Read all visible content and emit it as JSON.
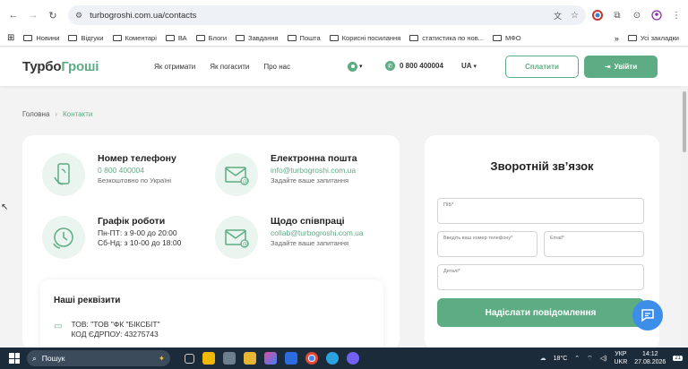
{
  "browser": {
    "url": "turbogroshi.com.ua/contacts"
  },
  "bookmarks": {
    "items": [
      "Новини",
      "Відгуки",
      "Коментарі",
      "ВА",
      "Блоги",
      "Завдання",
      "Пошта",
      "Корисні посилання",
      "статистика по нов...",
      "МФО"
    ],
    "all": "Усі закладки"
  },
  "header": {
    "logo_a": "Турбо",
    "logo_b": "Гроші",
    "nav": [
      "Як отримати",
      "Як погасити",
      "Про нас"
    ],
    "phone": "0 800 400004",
    "lang": "UA",
    "pay": "Сплатити",
    "login": "Увійти"
  },
  "breadcrumb": {
    "home": "Головна",
    "current": "Контакти"
  },
  "contacts": {
    "phone": {
      "title": "Номер телефону",
      "value": "0 800 400004",
      "note": "Безкоштовно по Україні"
    },
    "email": {
      "title": "Електронна пошта",
      "value": "info@turbogroshi.com.ua",
      "note": "Задайте ваше запитання"
    },
    "schedule": {
      "title": "Графік роботи",
      "line1": "Пн-ПТ: з 9-00 до 20:00",
      "line2": "Сб-Нд: з 10-00 до 18:00"
    },
    "partner": {
      "title": "Щодо співпраці",
      "value": "collab@turbogroshi.com.ua",
      "note": "Задайте ваше запитання"
    }
  },
  "requisites": {
    "title": "Наші реквізити",
    "line1": "ТОВ: \"ТОВ \"ФК \"БІКСБІТ\"",
    "line2": "КОД ЄДРПОУ: 43275743"
  },
  "feedback": {
    "title": "Зворотній зв’язок",
    "name_label": "ПІБ*",
    "phone_label": "Введіть ваш номер телефону*",
    "email_label": "Email*",
    "details_label": "Деталі*",
    "submit": "Надіслати повідомлення"
  },
  "taskbar": {
    "search": "Пошук",
    "weather": "18°C",
    "lang1": "УКР",
    "lang2": "UKR",
    "time": "14:12",
    "date": "27.08.2026",
    "notif": "21"
  }
}
